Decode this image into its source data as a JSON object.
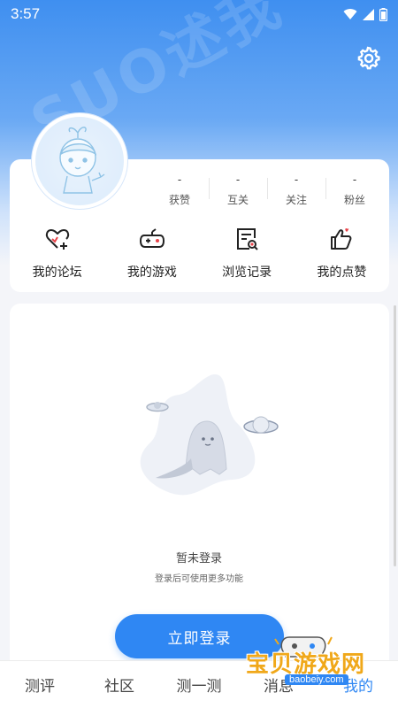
{
  "status": {
    "time": "3:57"
  },
  "header": {
    "watermark": "SUO述我"
  },
  "stats": [
    {
      "value": "-",
      "label": "获赞"
    },
    {
      "value": "-",
      "label": "互关"
    },
    {
      "value": "-",
      "label": "关注"
    },
    {
      "value": "-",
      "label": "粉丝"
    }
  ],
  "quick": [
    {
      "label": "我的论坛",
      "icon": "heart-plus-icon"
    },
    {
      "label": "我的游戏",
      "icon": "gamepad-icon"
    },
    {
      "label": "浏览记录",
      "icon": "history-doc-icon"
    },
    {
      "label": "我的点赞",
      "icon": "thumbs-up-icon"
    }
  ],
  "empty": {
    "title": "暂未登录",
    "subtitle": "登录后可使用更多功能",
    "button": "立即登录"
  },
  "tabs": [
    {
      "label": "测评",
      "active": false
    },
    {
      "label": "社区",
      "active": false
    },
    {
      "label": "测一测",
      "active": false
    },
    {
      "label": "消息",
      "active": false
    },
    {
      "label": "我的",
      "active": true
    }
  ],
  "brand": {
    "name": "宝贝游戏网",
    "url": "baobeiy.com"
  },
  "colors": {
    "accent": "#2f87f3",
    "hero_top": "#3f8ff0",
    "icon_red": "#e8444a"
  }
}
